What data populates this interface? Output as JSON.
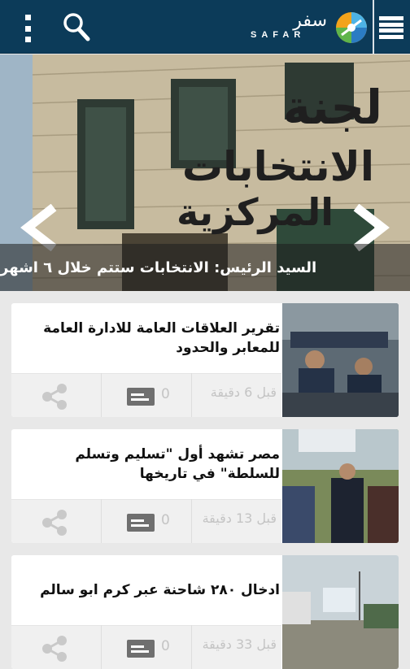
{
  "app": {
    "logo_arabic": "سفر",
    "logo_latin": "SAFAR"
  },
  "icons": {
    "overflow": "more-vertical-icon",
    "search": "search-icon",
    "menu": "hamburger-menu-icon",
    "share": "share-icon",
    "comment": "comment-icon",
    "prev": "chevron-left-icon",
    "next": "chevron-right-icon"
  },
  "colors": {
    "topbar": "#0c3b59",
    "card": "#ffffff",
    "footer": "#f0f0f0",
    "muted": "#c4c4c4"
  },
  "hero": {
    "caption": "السيد الرئيس: الانتخابات ستتم خلال ٦ اشهر",
    "sign_line1": "لجنة",
    "sign_line2": "الانتخابات",
    "sign_line3": "المركزية"
  },
  "articles": [
    {
      "title": "تقرير العلاقات العامة للادارة العامة للمعابر والحدود",
      "time": "قبل 6 دقيقة",
      "comments": "0"
    },
    {
      "title": "مصر تشهد أول \"تسليم وتسلم للسلطة\" في تاريخها",
      "time": "قبل 13 دقيقة",
      "comments": "0"
    },
    {
      "title": "ادخال ٢٨٠ شاحنة عبر كرم ابو سالم",
      "time": "قبل 33 دقيقة",
      "comments": "0"
    }
  ]
}
